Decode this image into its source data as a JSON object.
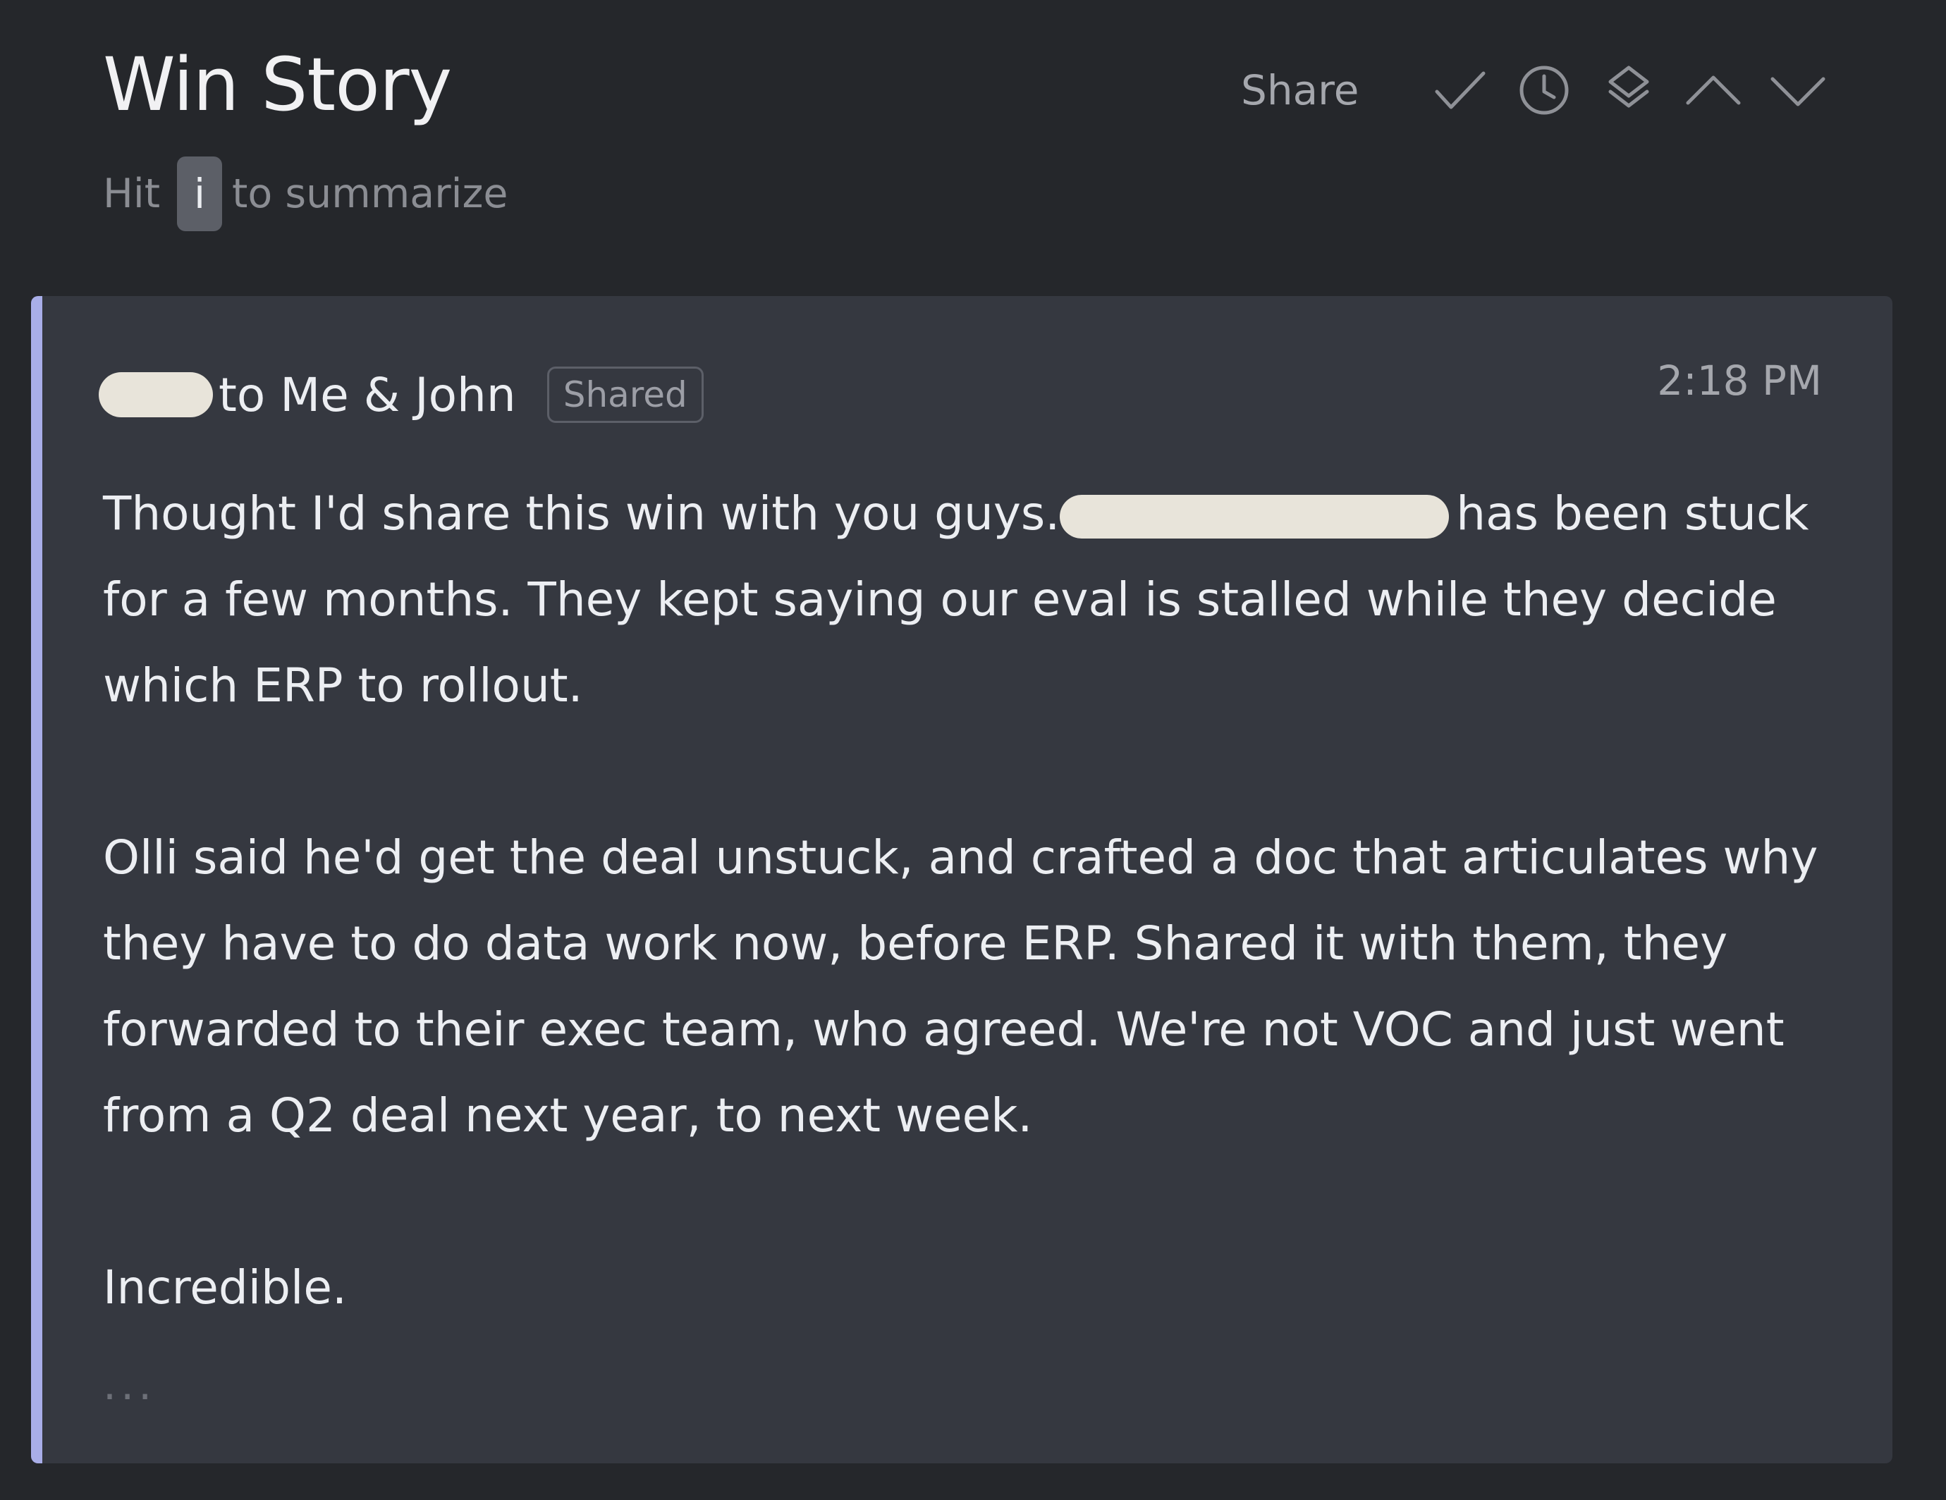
{
  "header": {
    "title": "Win Story",
    "hint_prefix": "Hit",
    "hint_key": "i",
    "hint_suffix": "to summarize"
  },
  "toolbar": {
    "share_label": "Share",
    "icons": [
      "checkmark-icon",
      "clock-icon",
      "layers-icon",
      "chevron-up-icon",
      "chevron-down-icon"
    ]
  },
  "message": {
    "recipients": "to Me & John",
    "badge": "Shared",
    "time": "2:18 PM",
    "line1_before": "Thought I'd share this win with you guys.",
    "line1_after": "has been stuck",
    "line2": "for a few months. They kept saying our eval is stalled while they decide",
    "line3": "which ERP to rollout.",
    "line4": "Olli said he'd get the deal unstuck, and crafted a doc that articulates why",
    "line5": "they have to do data work now, before ERP. Shared it with them, they",
    "line6": "forwarded to their exec team, who agreed. We're not VOC and just went",
    "line7": "from a Q2 deal next year, to next week.",
    "line8": "Incredible.",
    "more": "..."
  },
  "colors": {
    "background": "#25272b",
    "card": "#353840",
    "accent_bar": "#a9aee8",
    "text": "#eceef2",
    "muted": "#8b8d93",
    "redaction": "#e8e4da"
  }
}
